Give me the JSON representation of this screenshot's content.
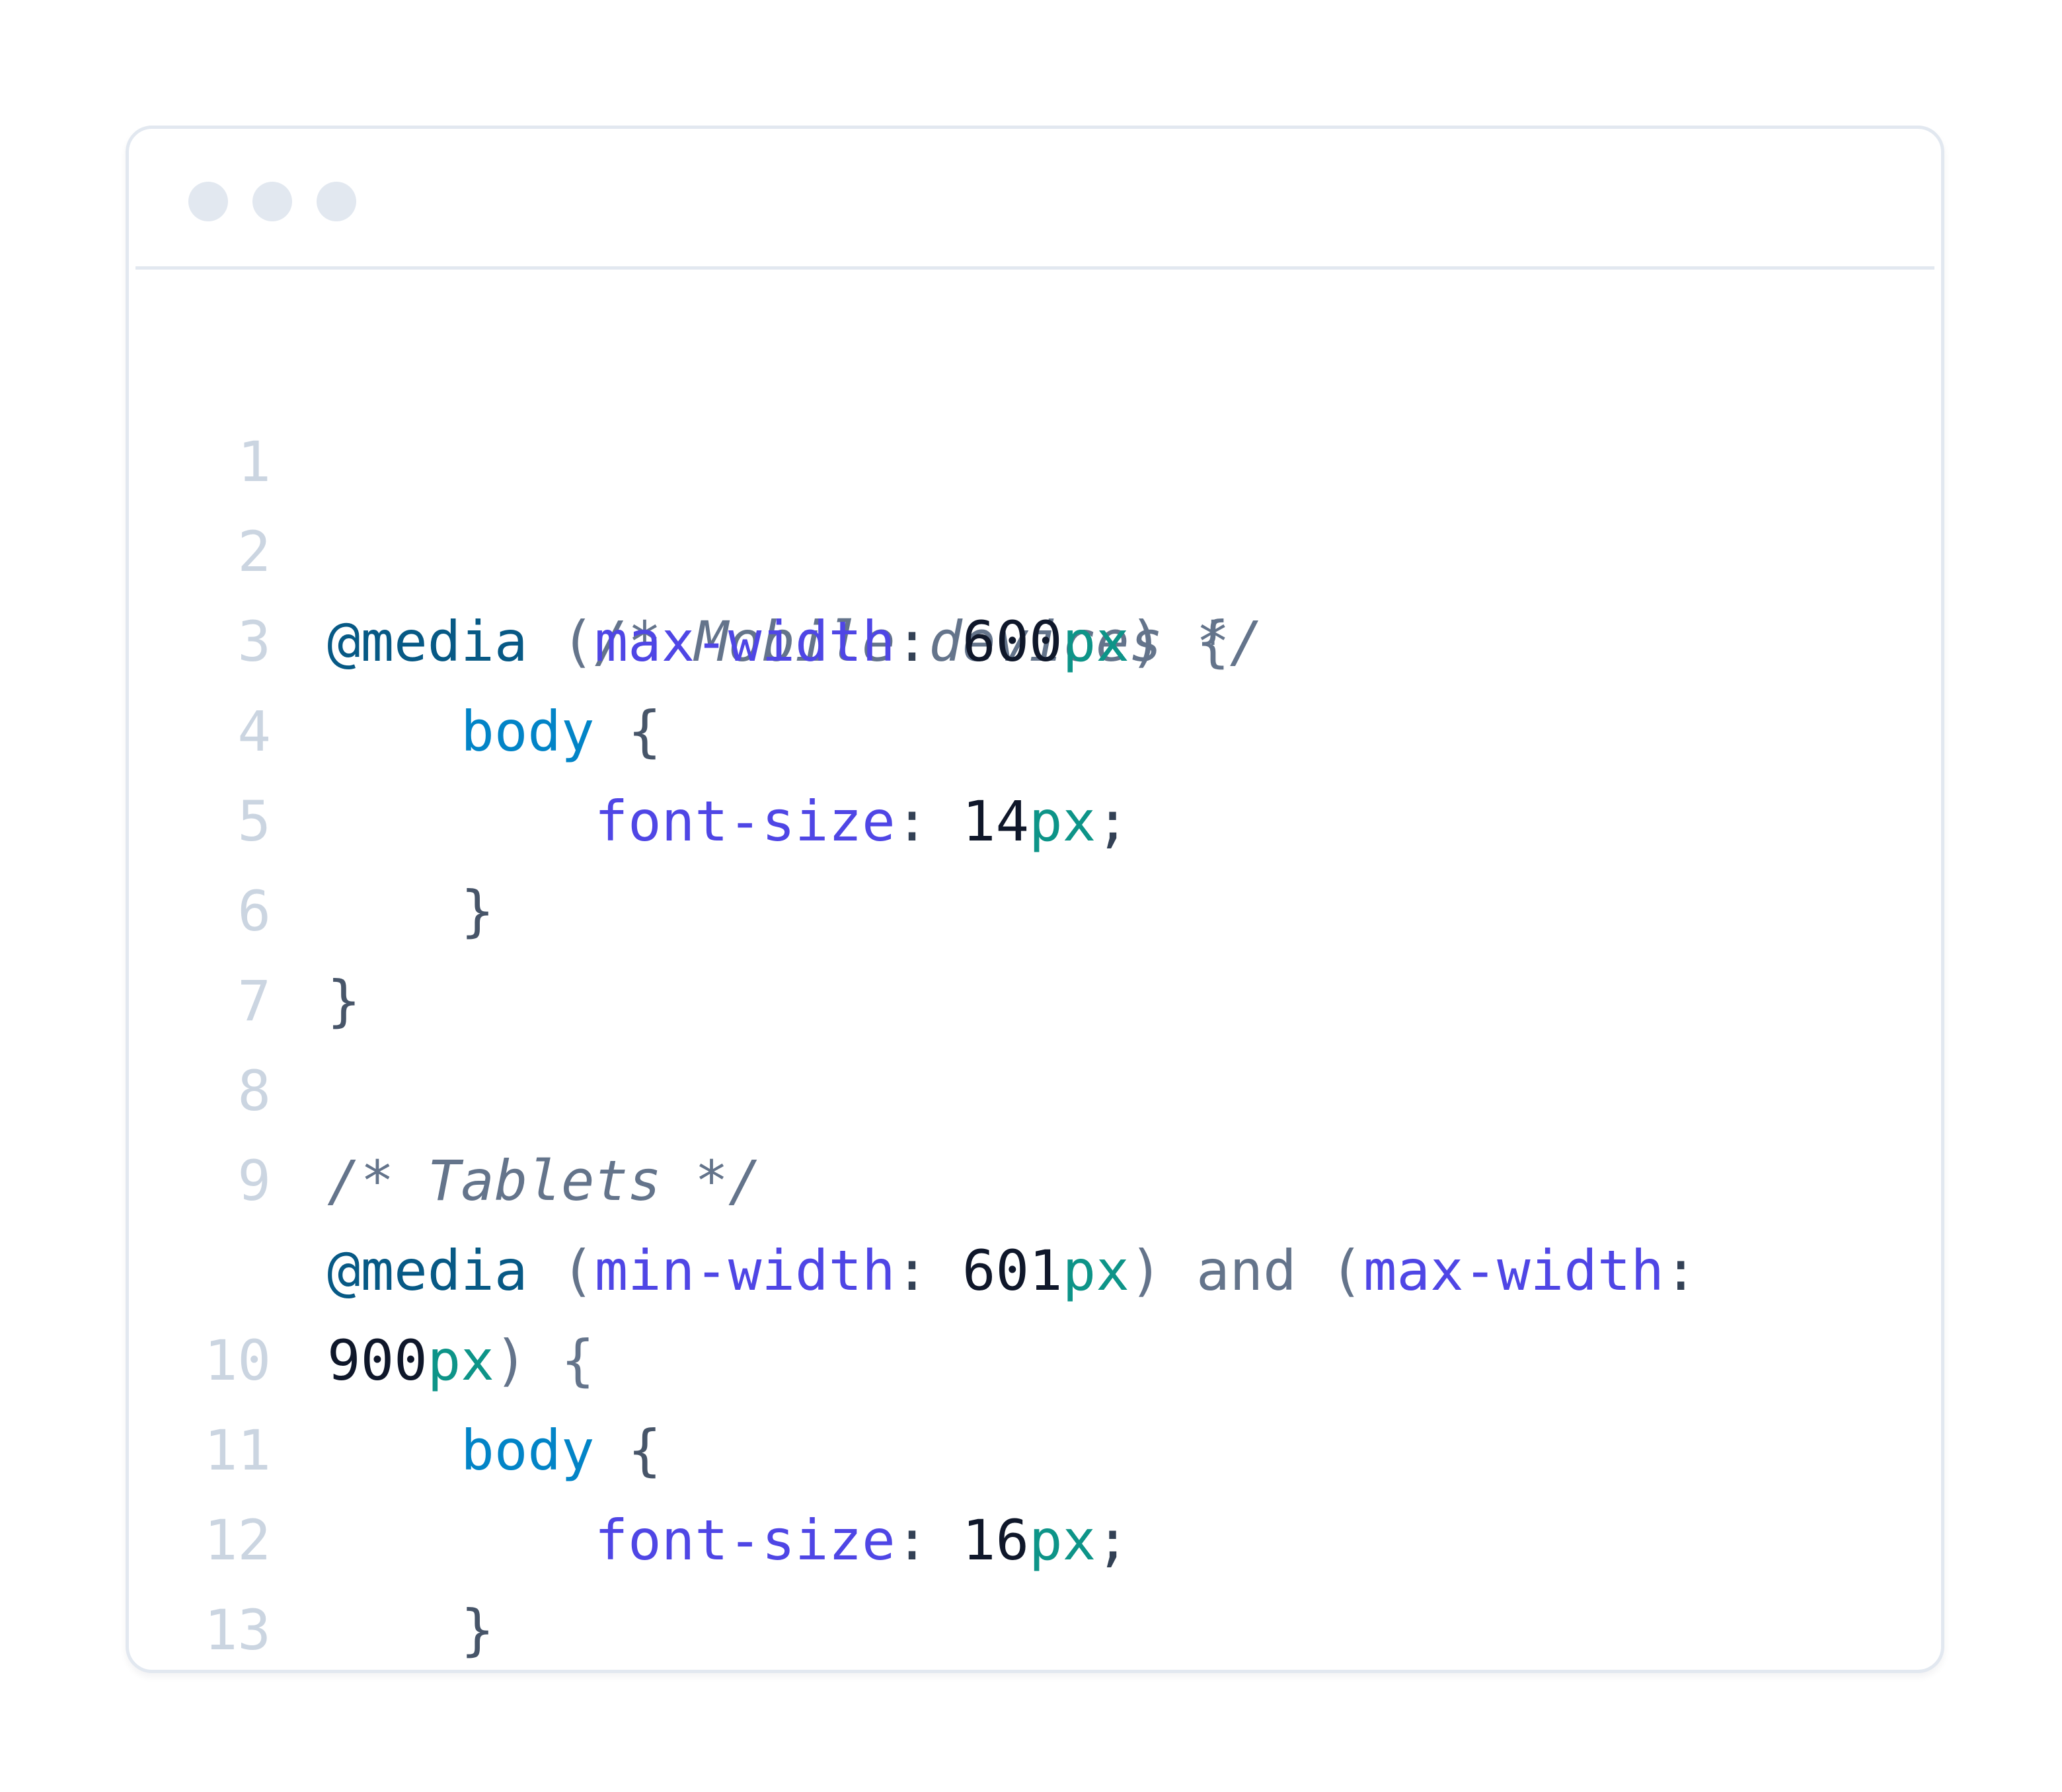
{
  "code_window": {
    "line_numbers": [
      "1",
      "2",
      "3",
      "4",
      "5",
      "6",
      "7",
      "8",
      "9",
      "",
      "10",
      "11",
      "12",
      "13"
    ],
    "lines": [
      {
        "t": [
          {
            "text": "/* Mobile devices */",
            "kind": "comment"
          }
        ]
      },
      {
        "t": [
          {
            "text": "@media",
            "kind": "at"
          },
          {
            "text": " (",
            "kind": "paren"
          },
          {
            "text": "max-width",
            "kind": "prop"
          },
          {
            "text": ": ",
            "kind": "punct"
          },
          {
            "text": "600",
            "kind": "num"
          },
          {
            "text": "px",
            "kind": "unit"
          },
          {
            "text": ") {",
            "kind": "paren"
          }
        ]
      },
      {
        "t": [
          {
            "text": "    body",
            "kind": "sel"
          },
          {
            "text": " {",
            "kind": "brace"
          }
        ]
      },
      {
        "t": [
          {
            "text": "        font-size",
            "kind": "prop"
          },
          {
            "text": ": ",
            "kind": "punct"
          },
          {
            "text": "14",
            "kind": "num"
          },
          {
            "text": "px",
            "kind": "unit"
          },
          {
            "text": ";",
            "kind": "punct"
          }
        ]
      },
      {
        "t": [
          {
            "text": "    }",
            "kind": "brace"
          }
        ]
      },
      {
        "t": [
          {
            "text": "}",
            "kind": "brace"
          }
        ]
      },
      {
        "t": []
      },
      {
        "t": [
          {
            "text": "/* Tablets */",
            "kind": "comment"
          }
        ]
      },
      {
        "t": [
          {
            "text": "@media",
            "kind": "at"
          },
          {
            "text": " (",
            "kind": "paren"
          },
          {
            "text": "min-width",
            "kind": "prop"
          },
          {
            "text": ": ",
            "kind": "punct"
          },
          {
            "text": "601",
            "kind": "num"
          },
          {
            "text": "px",
            "kind": "unit"
          },
          {
            "text": ") ",
            "kind": "paren"
          },
          {
            "text": "and",
            "kind": "kw"
          },
          {
            "text": " (",
            "kind": "paren"
          },
          {
            "text": "max-width",
            "kind": "prop"
          },
          {
            "text": ":",
            "kind": "punct"
          }
        ]
      },
      {
        "t": [
          {
            "text": "900",
            "kind": "num"
          },
          {
            "text": "px",
            "kind": "unit"
          },
          {
            "text": ") {",
            "kind": "paren"
          }
        ]
      },
      {
        "t": [
          {
            "text": "    body",
            "kind": "sel"
          },
          {
            "text": " {",
            "kind": "brace"
          }
        ]
      },
      {
        "t": [
          {
            "text": "        font-size",
            "kind": "prop"
          },
          {
            "text": ": ",
            "kind": "punct"
          },
          {
            "text": "16",
            "kind": "num"
          },
          {
            "text": "px",
            "kind": "unit"
          },
          {
            "text": ";",
            "kind": "punct"
          }
        ]
      },
      {
        "t": [
          {
            "text": "    }",
            "kind": "brace"
          }
        ]
      },
      {
        "t": [
          {
            "text": "}",
            "kind": "brace"
          }
        ]
      }
    ]
  },
  "colors": {
    "comment": "#64748b",
    "at_rule": "#075985",
    "property": "#4f46e5",
    "number": "#0f172a",
    "unit": "#0d9488",
    "selector": "#0284c7",
    "line_number": "#cbd5e1",
    "border": "#e2e8f0"
  }
}
